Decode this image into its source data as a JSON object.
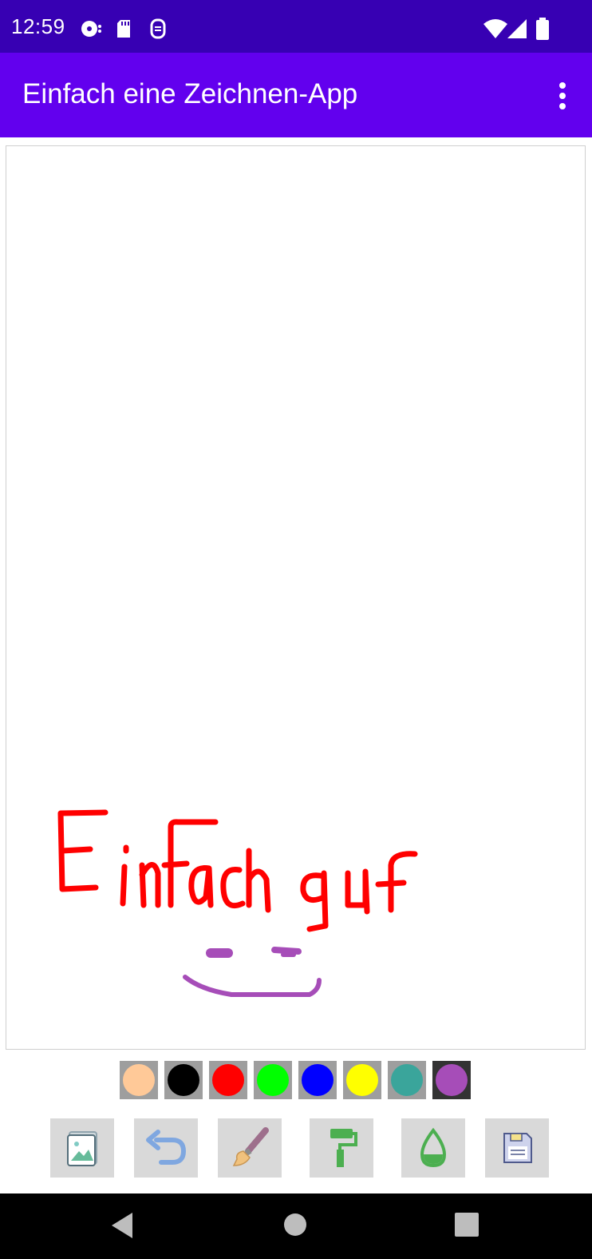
{
  "status_bar": {
    "time": "12:59",
    "icons": [
      "media-icon",
      "sd-card-icon",
      "sync-icon",
      "wifi-icon",
      "signal-icon",
      "battery-icon"
    ]
  },
  "app_bar": {
    "title": "Einfach eine Zeichnen-App",
    "menu_icon": "more-vert-icon"
  },
  "canvas": {
    "drawing_text": "Einfach gut",
    "text_color": "#ff0000",
    "smiley_color": "#a64db8"
  },
  "palette": {
    "colors": [
      {
        "name": "skin",
        "hex": "#ffc998"
      },
      {
        "name": "black",
        "hex": "#000000"
      },
      {
        "name": "red",
        "hex": "#ff0000"
      },
      {
        "name": "green",
        "hex": "#00ff00"
      },
      {
        "name": "blue",
        "hex": "#0000ff"
      },
      {
        "name": "yellow",
        "hex": "#ffff00"
      },
      {
        "name": "teal",
        "hex": "#3aa59b"
      },
      {
        "name": "purple",
        "hex": "#a64db8"
      }
    ],
    "selected": "purple"
  },
  "toolbar": {
    "tools": [
      "gallery-icon",
      "undo-icon",
      "brush-icon",
      "paint-roller-icon",
      "water-drop-icon",
      "save-icon"
    ]
  },
  "nav_bar": {
    "buttons": [
      "back-icon",
      "home-icon",
      "recents-icon"
    ]
  }
}
